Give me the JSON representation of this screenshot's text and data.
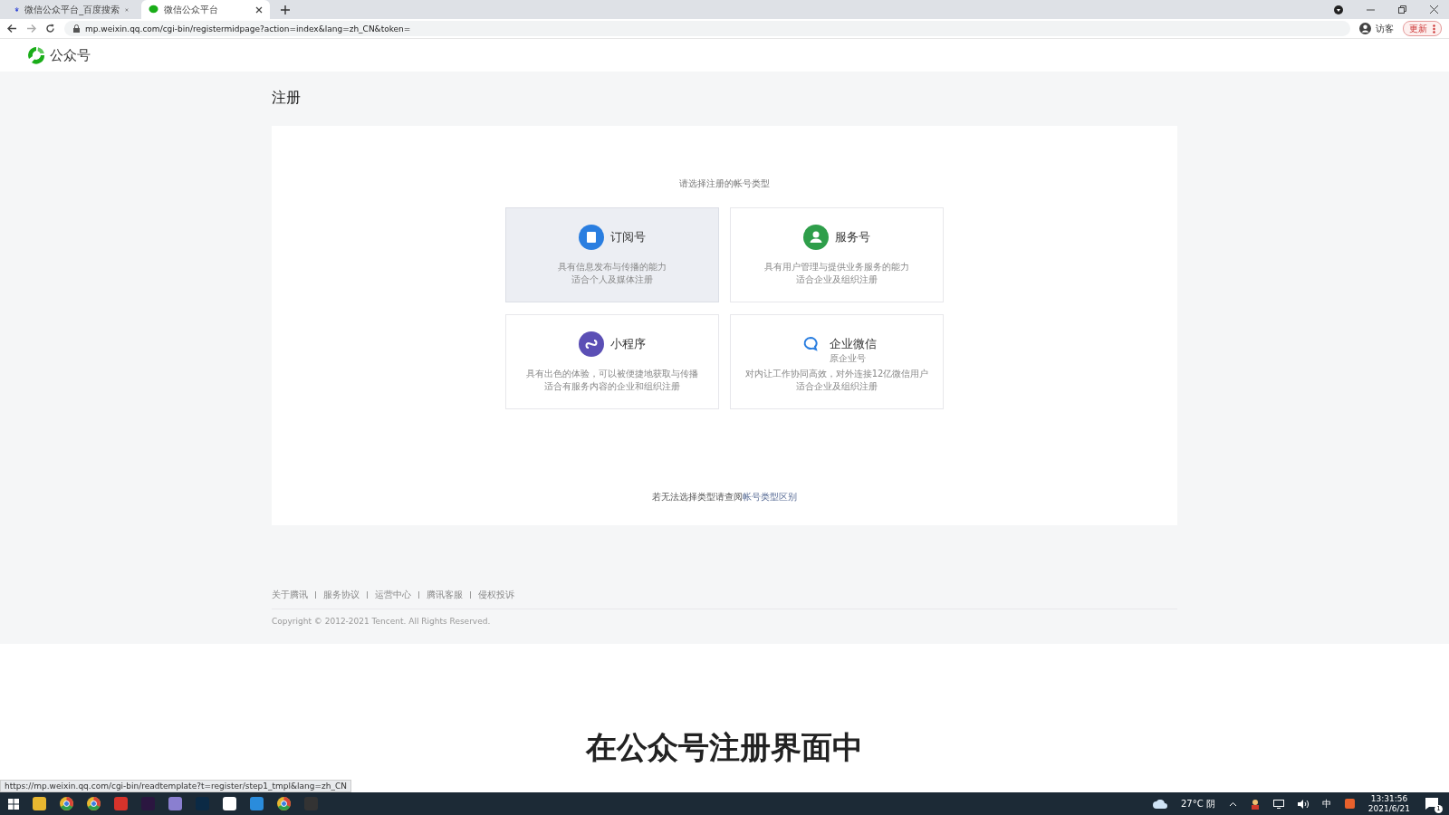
{
  "browser": {
    "tabs": [
      {
        "title": "微信公众平台_百度搜索",
        "selected": false
      },
      {
        "title": "微信公众平台",
        "selected": true
      }
    ],
    "url": "mp.weixin.qq.com/cgi-bin/registermidpage?action=index&lang=zh_CN&token=",
    "profile": "访客",
    "update_button": "更新"
  },
  "header": {
    "logo_text": "公众号"
  },
  "page": {
    "title": "注册",
    "prompt": "请选择注册的帐号类型",
    "account_types": [
      {
        "name": "订阅号",
        "hovered": true,
        "lines": [
          "具有信息发布与传播的能力",
          "适合个人及媒体注册"
        ]
      },
      {
        "name": "服务号",
        "hovered": false,
        "lines": [
          "具有用户管理与提供业务服务的能力",
          "适合企业及组织注册"
        ]
      },
      {
        "name": "小程序",
        "hovered": false,
        "lines": [
          "具有出色的体验，可以被便捷地获取与传播",
          "适合有服务内容的企业和组织注册"
        ]
      },
      {
        "name": "企业微信",
        "subname": "原企业号",
        "hovered": false,
        "lines": [
          "对内让工作协同高效，对外连接12亿微信用户",
          "适合企业及组织注册"
        ]
      }
    ],
    "help_text": "若无法选择类型请查阅",
    "help_link": "帐号类型区别"
  },
  "footer": {
    "links": [
      "关于腾讯",
      "服务协议",
      "运营中心",
      "腾讯客服",
      "侵权投诉"
    ],
    "copyright": "Copyright © 2012-2021 Tencent. All Rights Reserved."
  },
  "video_caption": "在公众号注册界面中",
  "status_url": "https://mp.weixin.qq.com/cgi-bin/readtemplate?t=register/step1_tmpl&lang=zh_CN",
  "taskbar": {
    "weather": "27°C 阴",
    "ime": "中",
    "time": "13:31:56",
    "date": "2021/6/21",
    "notifications": "1"
  }
}
